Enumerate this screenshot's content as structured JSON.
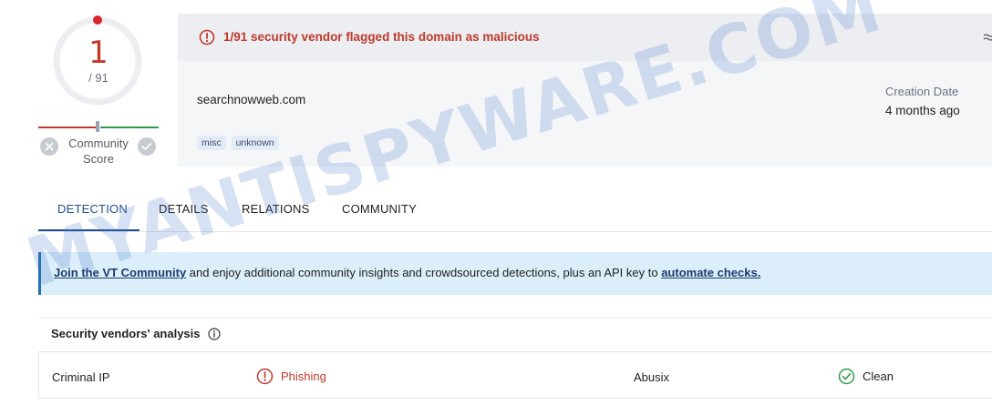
{
  "score": {
    "detections": "1",
    "total": "/ 91",
    "community_label": "Community\nScore"
  },
  "alert": {
    "text": "1/91 security vendor flagged this domain as malicious"
  },
  "domain": {
    "name": "searchnowweb.com",
    "tags": [
      "misc",
      "unknown"
    ],
    "creation_label": "Creation Date",
    "creation_value": "4 months ago"
  },
  "tabs": [
    {
      "label": "DETECTION",
      "active": true
    },
    {
      "label": "DETAILS",
      "active": false
    },
    {
      "label": "RELATIONS",
      "active": false
    },
    {
      "label": "COMMUNITY",
      "active": false
    }
  ],
  "banner": {
    "link1": "Join the VT Community",
    "middle": " and enjoy additional community insights and crowdsourced detections, plus an API key to ",
    "link2": "automate checks."
  },
  "vendors": {
    "title": "Security vendors' analysis",
    "rows": [
      {
        "left": {
          "name": "Criminal IP",
          "result": "Phishing",
          "status": "malicious"
        },
        "right": {
          "name": "Abusix",
          "result": "Clean",
          "status": "clean"
        }
      }
    ]
  },
  "watermark": "MYANTISPYWARE.COM",
  "colors": {
    "malicious": "#c0392b",
    "clean": "#2e9b4a",
    "accent": "#1f4e96"
  }
}
